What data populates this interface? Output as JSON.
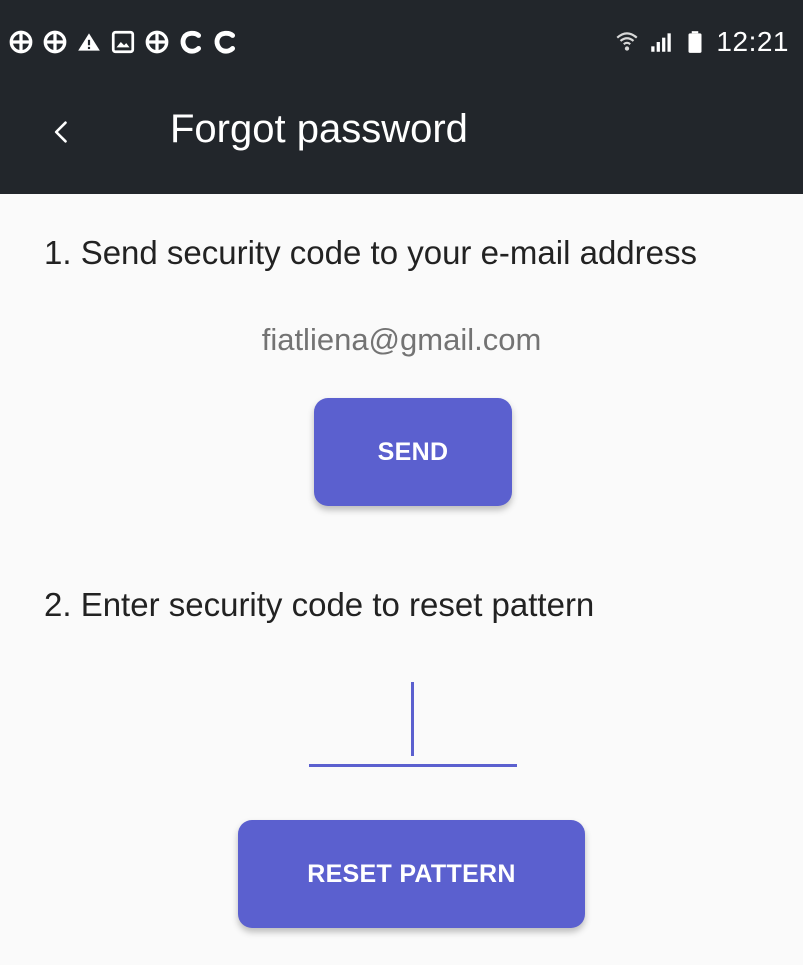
{
  "status_bar": {
    "time": "12:21",
    "left_icons": [
      "circle-grid-icon",
      "circle-grid-icon",
      "warning-icon",
      "image-icon",
      "circle-grid-icon",
      "c-icon",
      "c-icon"
    ],
    "right_icons": [
      "wifi-icon",
      "signal-icon",
      "battery-icon"
    ]
  },
  "toolbar": {
    "back_icon": "chevron-left-icon",
    "title": "Forgot password"
  },
  "step1": {
    "label": "1. Send security code to your e-mail address",
    "email": "fiatliena@gmail.com",
    "button_label": "SEND"
  },
  "step2": {
    "label": "2. Enter security code to reset pattern",
    "code_value": "",
    "button_label": "RESET PATTERN"
  },
  "colors": {
    "app_bar": "#22262b",
    "accent": "#5b60cf",
    "background": "#fafafa",
    "text_primary": "#222222",
    "text_secondary": "#737373"
  }
}
